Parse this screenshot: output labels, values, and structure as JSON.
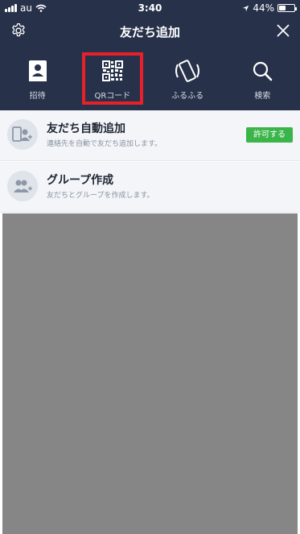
{
  "status_bar": {
    "carrier": "au",
    "time": "3:40",
    "battery": "44%",
    "battery_level": 0.44
  },
  "header": {
    "title": "友だち追加",
    "settings_icon": "gear-icon",
    "close_icon": "close-icon"
  },
  "tabs": [
    {
      "label": "招待",
      "icon": "invite-contact-icon"
    },
    {
      "label": "QRコード",
      "icon": "qr-code-icon"
    },
    {
      "label": "ふるふる",
      "icon": "shake-phone-icon"
    },
    {
      "label": "検索",
      "icon": "search-icon"
    }
  ],
  "auto_add": {
    "title": "友だち自動追加",
    "desc": "連絡先を自動で友だち追加します。",
    "button": "許可する"
  },
  "group": {
    "title": "グループ作成",
    "desc": "友だちとグループを作成します。"
  },
  "colors": {
    "header_bg": "#27324a",
    "highlight": "#e8202a",
    "allow_button": "#3bb54a",
    "overlay": "#868686"
  }
}
